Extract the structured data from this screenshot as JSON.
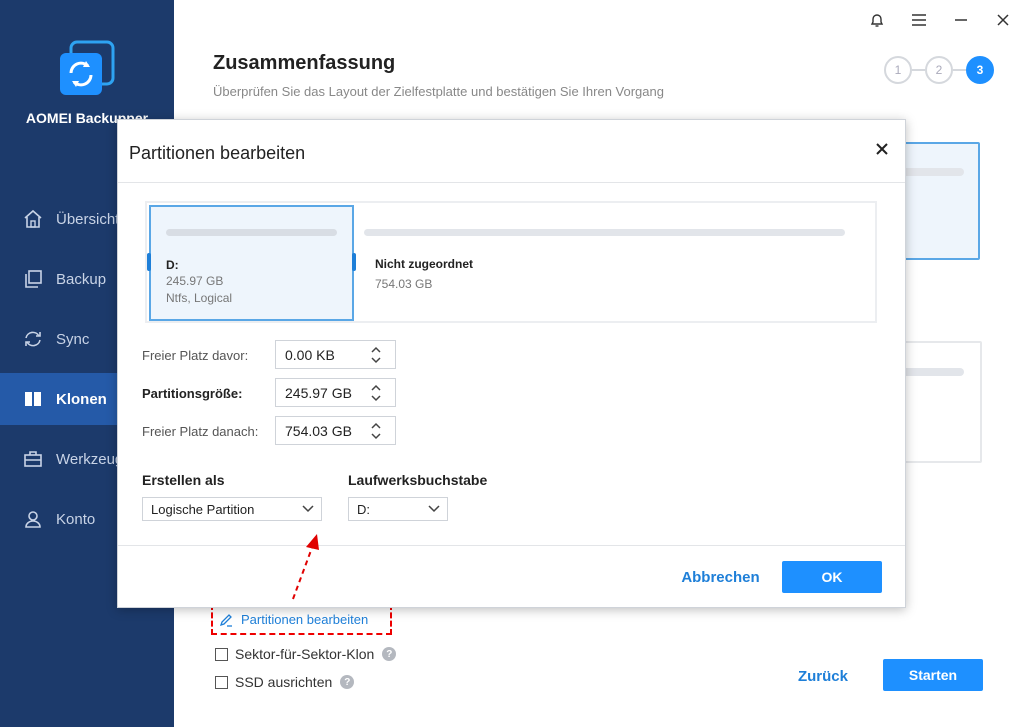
{
  "app": {
    "name": "AOMEI Backupper"
  },
  "sidebar": {
    "items": [
      {
        "label": "Übersicht",
        "icon": "home-icon"
      },
      {
        "label": "Backup",
        "icon": "copy-icon"
      },
      {
        "label": "Sync",
        "icon": "sync-icon"
      },
      {
        "label": "Klonen",
        "icon": "clone-icon",
        "active": true
      },
      {
        "label": "Werkzeuge",
        "icon": "toolbox-icon"
      },
      {
        "label": "Konto",
        "icon": "user-icon"
      }
    ]
  },
  "header": {
    "title": "Zusammenfassung",
    "subtitle": "Überprüfen Sie das Layout der Zielfestplatte und bestätigen Sie Ihren Vorgang",
    "steps": [
      "1",
      "2",
      "3"
    ],
    "active_step": "3"
  },
  "main": {
    "edit_partitions_link": "Partitionen bearbeiten",
    "sector_clone_label": "Sektor-für-Sektor-Klon",
    "ssd_align_label": "SSD ausrichten",
    "back_button": "Zurück",
    "start_button": "Starten",
    "help_glyph": "?"
  },
  "dialog": {
    "title": "Partitionen bearbeiten",
    "partitions": [
      {
        "name": "D:",
        "size": "245.97 GB",
        "fs": "Ntfs, Logical"
      },
      {
        "name": "Nicht zugeordnet",
        "size": "754.03 GB"
      }
    ],
    "fields": {
      "free_before": {
        "label": "Freier Platz davor:",
        "value": "0.00 KB"
      },
      "size": {
        "label": "Partitionsgröße:",
        "value": "245.97 GB"
      },
      "free_after": {
        "label": "Freier Platz danach:",
        "value": "754.03 GB"
      }
    },
    "create_as": {
      "label": "Erstellen als",
      "value": "Logische Partition"
    },
    "drive_letter": {
      "label": "Laufwerksbuchstabe",
      "value": "D:"
    },
    "cancel_button": "Abbrechen",
    "ok_button": "OK"
  },
  "colors": {
    "sidebar": "#1c3a6b",
    "sidebar_active": "#255aa8",
    "accent": "#1e90ff",
    "link": "#1e7fd8",
    "annotation": "#e00000"
  }
}
